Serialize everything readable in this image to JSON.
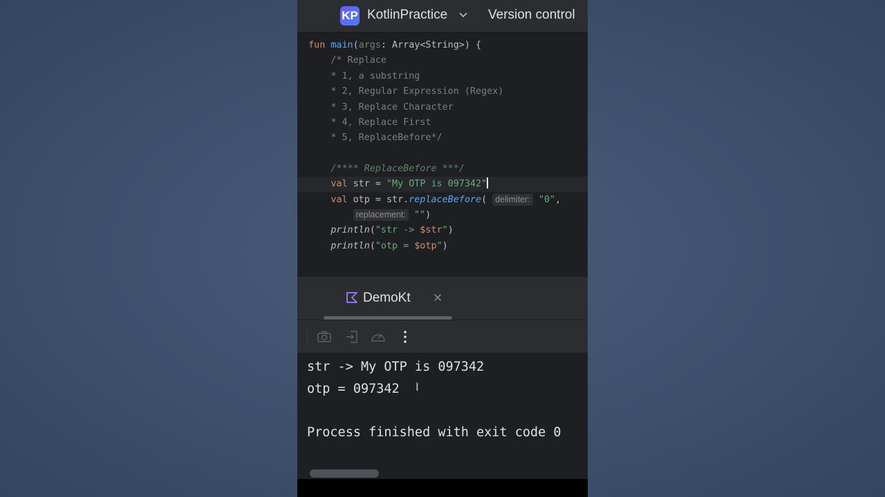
{
  "titlebar": {
    "project_badge": "KP",
    "project_name": "KotlinPractice",
    "version_control": "Version control"
  },
  "editor": {
    "lines": {
      "l0_fun": "fun ",
      "l0_main": "main",
      "l0_open": "(",
      "l0_args": "args",
      "l0_rest": ": Array<String>) {",
      "l1": "    /* Replace",
      "l2": "    * 1, a substring",
      "l3": "    * 2, Regular Expression (Regex)",
      "l4": "    * 3, Replace Character",
      "l5": "    * 4, Replace First",
      "l6": "    * 5, ReplaceBefore*/",
      "l8": "    /**** ReplaceBefore ***/",
      "l9_val": "    val",
      "l9_mid": " str = ",
      "l9_str": "\"My OTP is 097342\"",
      "l10_val": "    val",
      "l10_mid": " otp = str.",
      "l10_fn": "replaceBefore",
      "l10_open": "( ",
      "l10_hint": "delimiter:",
      "l10_str": " \"0\"",
      "l10_comma": ",",
      "l11_indent": "        ",
      "l11_hint": "replacement:",
      "l11_str": " \"\"",
      "l11_close": ")",
      "l12_fn": "    println",
      "l12_open": "(",
      "l12_str1": "\"str -> ",
      "l12_tpl": "$str",
      "l12_str2": "\"",
      "l12_close": ")",
      "l13_fn": "    println",
      "l13_open": "(",
      "l13_str1": "\"otp = ",
      "l13_tpl": "$otp",
      "l13_str2": "\"",
      "l13_close": ")"
    }
  },
  "run": {
    "tab_label": "DemoKt",
    "console": {
      "line1": "str -> My OTP is 097342",
      "line2": "otp = 097342",
      "line3": "Process finished with exit code 0"
    }
  },
  "icons": {
    "project_chevron": "chevron-down-icon",
    "kotlin_file": "kotlin-file-icon",
    "close": "close-icon",
    "screenshot": "camera-icon",
    "exit": "exit-icon",
    "profiler": "gauge-icon",
    "more": "more-vertical-icon"
  },
  "colors": {
    "background": "#3f5370",
    "editor_bg": "#1e1f22",
    "panel_bg": "#2b2d30",
    "keyword": "#cf8e6d",
    "function": "#56a8f5",
    "string": "#6aab73",
    "comment": "#7a7e85",
    "doc_comment": "#5f826b"
  }
}
